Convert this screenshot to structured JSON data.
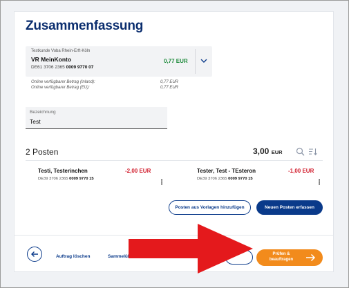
{
  "page": {
    "title": "Zusammenfassung"
  },
  "account": {
    "owner": "Testkunde Voba Rhein-Erft-Köln",
    "name": "VR MeinKonto",
    "iban_prefix": "DE61 3706 2365 ",
    "iban_suffix": "0009 9770 07",
    "balance": "0,77 EUR",
    "avail_inland_label": "Online verfügbarer Betrag (Inland):",
    "avail_inland_value": "0,77 EUR",
    "avail_eu_label": "Online verfügbarer Betrag (EU):",
    "avail_eu_value": "0,77 EUR"
  },
  "designation": {
    "label": "Bezeichnung",
    "value": "Test"
  },
  "posten": {
    "count_label": "2 Posten",
    "total": "3,00",
    "currency": "EUR",
    "items": [
      {
        "name": "Testi, Testerinchen",
        "amount": "-2,00 EUR",
        "iban_prefix": "DE39 3706 2365 ",
        "iban_suffix": "0009 9770 15"
      },
      {
        "name": "Tester, Test - TEsteron",
        "amount": "-1,00 EUR",
        "iban_prefix": "DE39 3706 2365 ",
        "iban_suffix": "0009 9770 15"
      }
    ]
  },
  "actions": {
    "add_from_templates": "Posten aus Vorlagen hinzufügen",
    "new_item": "Neuen Posten erfassen",
    "delete_order": "Auftrag löschen",
    "collective": "Sammelüb",
    "review_submit": "Prüfen & beauftragen"
  },
  "colors": {
    "brand": "#0a3a8a",
    "positive": "#1c8a3a",
    "negative": "#d11a2a",
    "cta": "#f28b1c",
    "annotation_arrow": "#e4191c"
  }
}
